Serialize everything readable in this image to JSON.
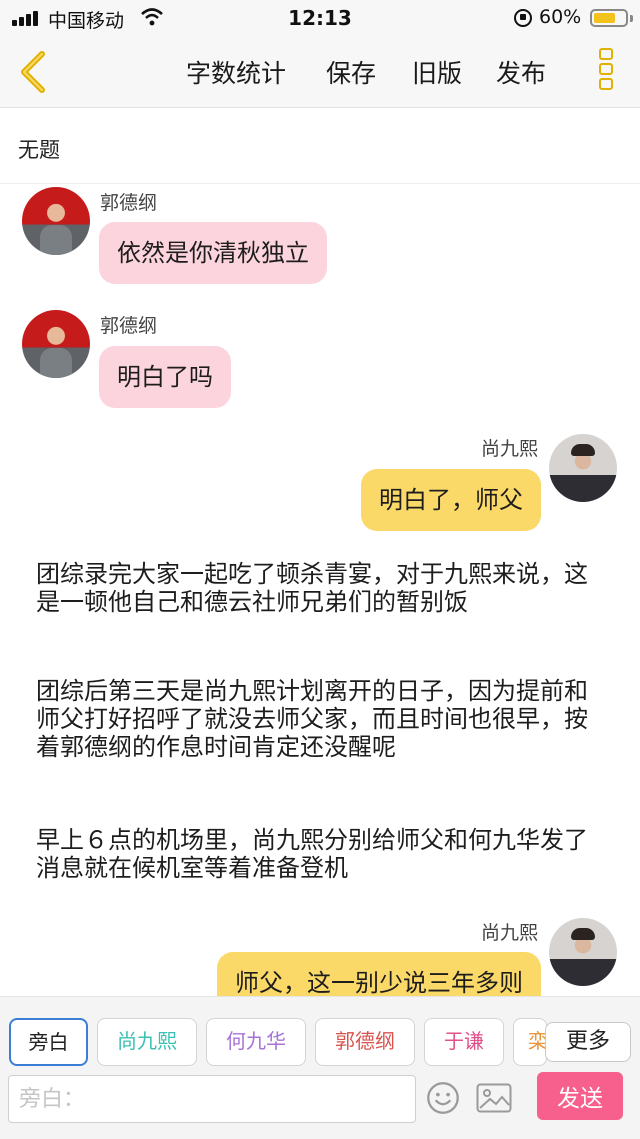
{
  "status": {
    "carrier": "中国移动",
    "time": "12:13",
    "battery": "60%"
  },
  "nav": {
    "word_count": "字数统计",
    "save": "保存",
    "old_version": "旧版",
    "publish": "发布"
  },
  "document": {
    "title": "无题"
  },
  "messages": [
    {
      "sender": "郭德纲",
      "text": "依然是你清秋独立"
    },
    {
      "sender": "郭德纲",
      "text": "明白了吗"
    },
    {
      "sender": "尚九熙",
      "text": "明白了，师父"
    },
    {
      "text": "团综录完大家一起吃了顿杀青宴，对于九熙来说，这是一顿他自己和德云社师兄弟们的暂别饭"
    },
    {
      "text": "团综后第三天是尚九熙计划离开的日子，因为提前和师父打好招呼了就没去师父家，而且时间也很早，按着郭德纲的作息时间肯定还没醒呢"
    },
    {
      "text": "早上６点的机场里，尚九熙分别给师父和何九华发了消息就在候机室等着准备登机"
    },
    {
      "sender": "尚九熙",
      "text": "师父，这一别少说三年多则"
    }
  ],
  "roles": [
    {
      "label": "旁白",
      "color": "#222222"
    },
    {
      "label": "尚九熙",
      "color": "#3cc0b4"
    },
    {
      "label": "何九华",
      "color": "#a773d8"
    },
    {
      "label": "郭德纲",
      "color": "#d9534f"
    },
    {
      "label": "于谦",
      "color": "#e0508a"
    },
    {
      "label": "栾",
      "color": "#e8963a"
    }
  ],
  "more_label": "更多",
  "input": {
    "placeholder": "旁白："
  },
  "send_label": "发送",
  "colors": {
    "accent_yellow": "#fbd969",
    "pink_bubble": "#fcd4dd",
    "send_button": "#f7608c"
  }
}
